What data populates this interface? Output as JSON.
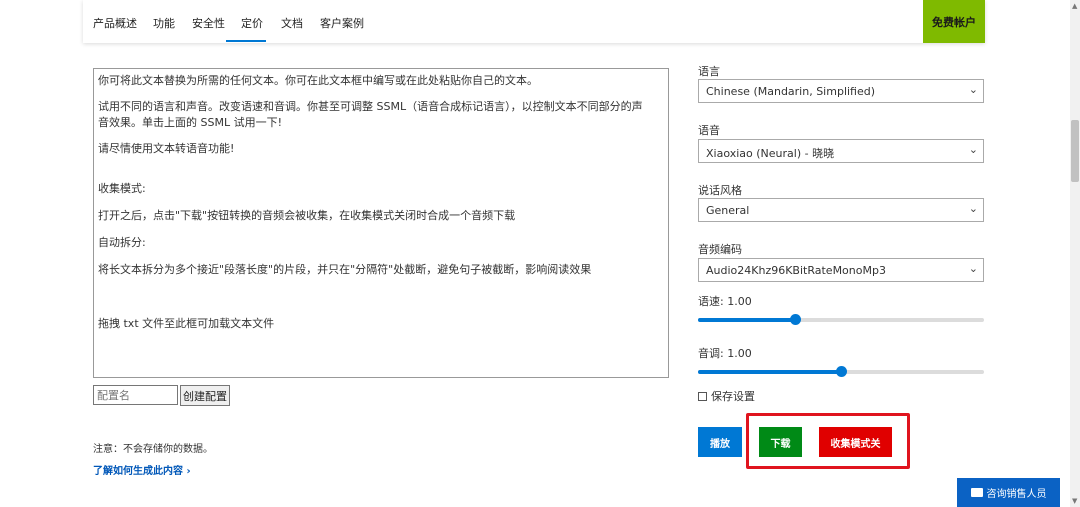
{
  "nav": {
    "tabs": [
      "产品概述",
      "功能",
      "安全性",
      "定价",
      "文档",
      "客户案例"
    ],
    "free_account": "免费帐户"
  },
  "editor": {
    "lines": [
      "你可将此文本替换为所需的任何文本。你可在此文本框中编写或在此处粘贴你自己的文本。",
      "试用不同的语言和声音。改变语速和音调。你甚至可调整 SSML（语音合成标记语言），以控制文本不同部分的声",
      "音效果。单击上面的 SSML 试用一下!",
      "请尽情使用文本转语音功能!",
      "收集模式:",
      "打开之后，点击\"下载\"按钮转换的音频会被收集，在收集模式关闭时合成一个音频下载",
      "自动拆分:",
      "将长文本拆分为多个接近\"段落长度\"的片段，并只在\"分隔符\"处截断，避免句子被截断，影响阅读效果",
      "拖拽 txt 文件至此框可加载文本文件"
    ]
  },
  "config": {
    "placeholder": "配置名",
    "create_label": "创建配置"
  },
  "note": "注意：不会存储你的数据。",
  "learn_more": "了解如何生成此内容 ›",
  "panel": {
    "language_label": "语言",
    "language_value": "Chinese (Mandarin, Simplified)",
    "voice_label": "语音",
    "voice_value": "Xiaoxiao (Neural) - 晓晓",
    "style_label": "说话风格",
    "style_value": "General",
    "codec_label": "音频编码",
    "codec_value": "Audio24Khz96KBitRateMonoMp3",
    "rate_label": "语速: 1.00",
    "rate_fraction": 0.34,
    "pitch_label": "音调: 1.00",
    "pitch_fraction": 0.5,
    "save_settings": "保存设置"
  },
  "buttons": {
    "play": "播放",
    "download": "下载",
    "collect": "收集模式关"
  },
  "chat": "咨询销售人员",
  "colors": {
    "accent_blue": "#0078d4",
    "free_green": "#7fba00",
    "download_green": "#008a16",
    "collect_red": "#e00000"
  }
}
